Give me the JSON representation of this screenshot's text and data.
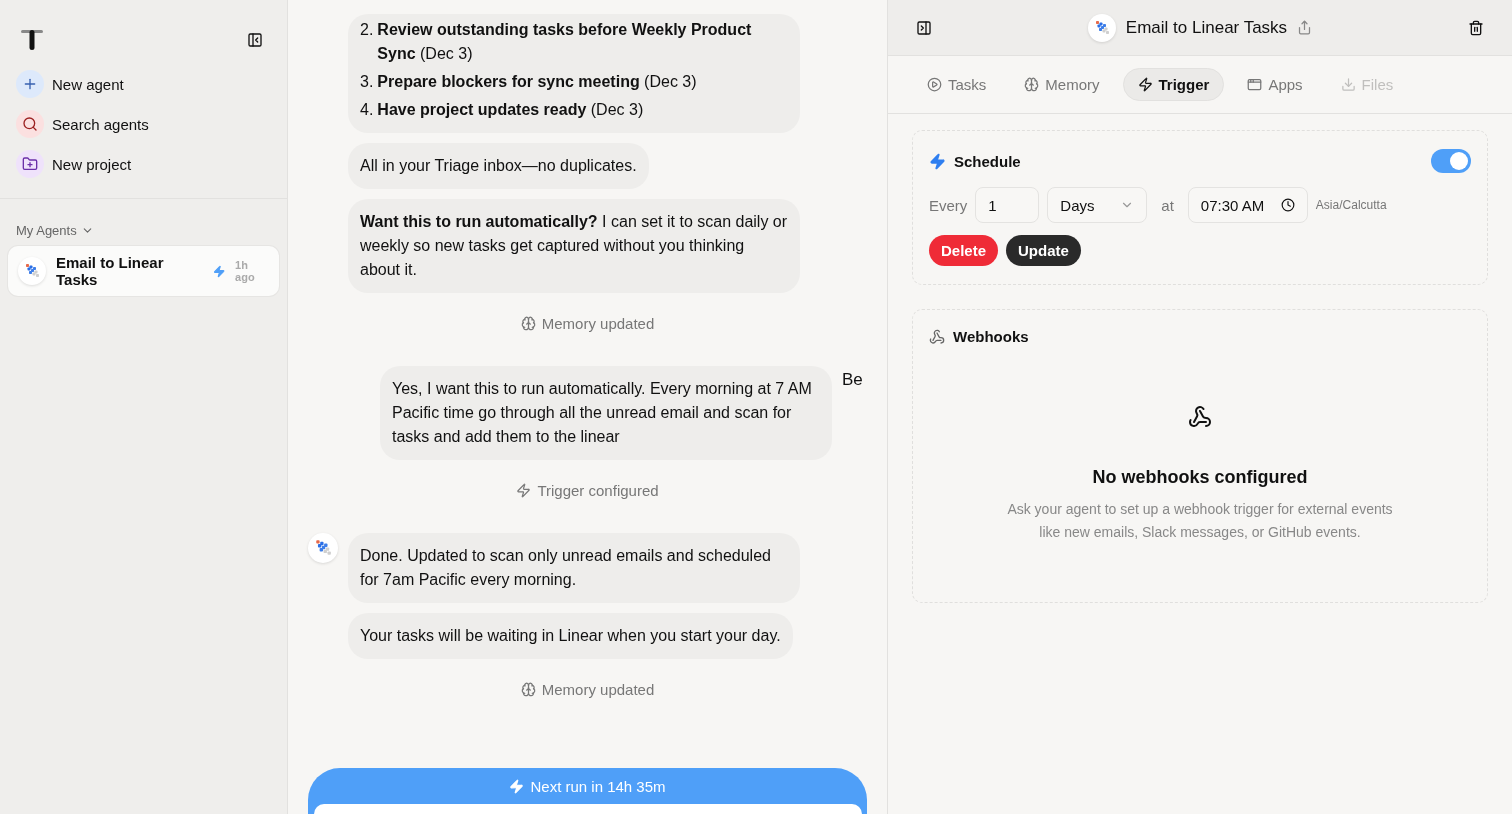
{
  "sidebar": {
    "items": [
      {
        "kind": "new",
        "label": "New agent"
      },
      {
        "kind": "search",
        "label": "Search agents"
      },
      {
        "kind": "project",
        "label": "New project"
      }
    ],
    "section": "My Agents",
    "agents": [
      {
        "name": "Email to Linear Tasks",
        "time": "1h ago",
        "selected": true,
        "triggered": true
      }
    ]
  },
  "chat": {
    "messages": [
      {
        "kind": "list",
        "items": [
          {
            "number": "2.",
            "text": "**Review outstanding tasks before Weekly Product Sync** (Dec 3)"
          },
          {
            "number": "3.",
            "text": "**Prepare blockers for sync meeting** (Dec 3)"
          },
          {
            "number": "4.",
            "text": "**Have project updates ready** (Dec 3)"
          }
        ]
      },
      {
        "kind": "assistant",
        "text": "All in your Triage inbox—no duplicates.",
        "avatar": false
      },
      {
        "kind": "assistant",
        "text": "**Want this to run automatically?** I can set it to scan daily or weekly so new tasks get captured without you thinking about it.",
        "avatar": false
      },
      {
        "kind": "memory_event",
        "text": "Memory updated"
      },
      {
        "kind": "user",
        "text": "Yes, I want this to run automatically. Every morning at 7 AM Pacific time go through all the unread email and scan for tasks and add them to the linear",
        "side_text": "Be"
      },
      {
        "kind": "trigger_event",
        "text": "Trigger configured"
      },
      {
        "kind": "assistant",
        "text": "Done. Updated to scan only unread emails and scheduled for 7am Pacific every morning.",
        "avatar": true
      },
      {
        "kind": "assistant",
        "text": "Your tasks will be waiting in Linear when you start your day.",
        "avatar": false
      },
      {
        "kind": "memory_event",
        "text": "Memory updated"
      }
    ],
    "next_run": "Next run in 14h 35m"
  },
  "panel": {
    "title": "Email to Linear Tasks",
    "tabs": [
      {
        "kind": "tasks",
        "label": "Tasks",
        "selected": false,
        "disabled": false
      },
      {
        "kind": "memory",
        "label": "Memory",
        "selected": false,
        "disabled": false
      },
      {
        "kind": "trigger",
        "label": "Trigger",
        "selected": true,
        "disabled": false
      },
      {
        "kind": "apps",
        "label": "Apps",
        "selected": false,
        "disabled": false
      },
      {
        "kind": "files",
        "label": "Files",
        "selected": false,
        "disabled": true
      }
    ],
    "schedule": {
      "title": "Schedule",
      "enabled": true,
      "every_label": "Every",
      "count": "1",
      "unit": "Days",
      "at_label": "at",
      "time": "07:30 AM",
      "timezone": "Asia/Calcutta",
      "buttons": [
        {
          "kind": "danger",
          "label": "Delete"
        },
        {
          "kind": "primary",
          "label": "Update"
        }
      ]
    },
    "webhooks": {
      "title": "Webhooks",
      "empty_title": "No webhooks configured",
      "empty_text": "Ask your agent to set up a webhook trigger for external events like new emails, Slack messages, or GitHub events."
    }
  }
}
